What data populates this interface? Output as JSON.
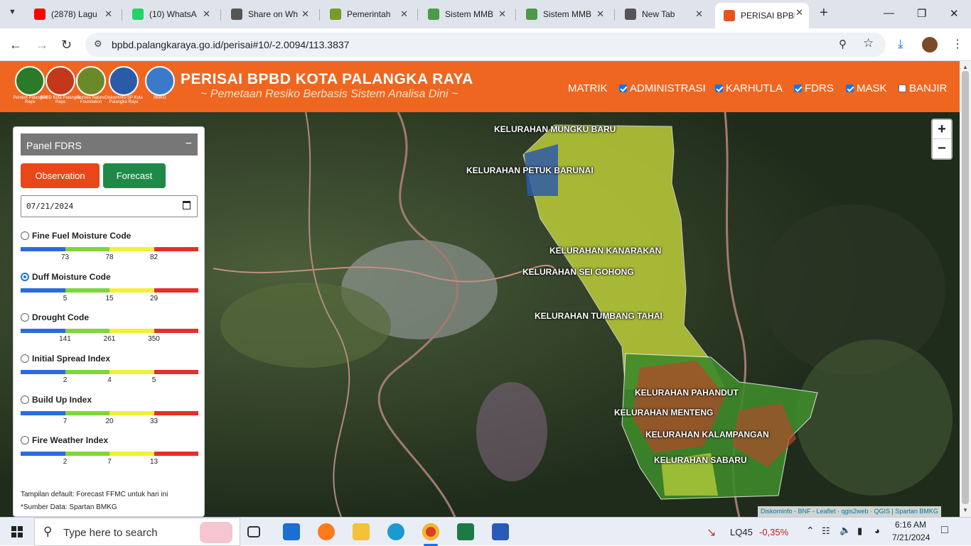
{
  "browser": {
    "tabs": [
      {
        "title": "(2878) Lagu",
        "icon": "youtube-icon",
        "color": "#ff0000"
      },
      {
        "title": "(10) WhatsA",
        "icon": "whatsapp-icon",
        "color": "#25d366"
      },
      {
        "title": "Share on Wh",
        "icon": "globe-icon",
        "color": "#555555"
      },
      {
        "title": "Pemerintah",
        "icon": "shield-icon",
        "color": "#7a9a2a"
      },
      {
        "title": "Sistem MMB",
        "icon": "map-icon",
        "color": "#4a9a4a"
      },
      {
        "title": "Sistem MMB",
        "icon": "map-icon",
        "color": "#4a9a4a"
      },
      {
        "title": "New Tab",
        "icon": "chrome-icon",
        "color": "#555555"
      },
      {
        "title": "PERISAI BPBD",
        "icon": "bpbd-icon",
        "color": "#e8521d"
      }
    ],
    "url": "bpbd.palangkaraya.go.id/perisai#10/-2.0094/113.3837"
  },
  "site": {
    "logos": [
      {
        "caption": "Pemkot Palangka Raya",
        "color": "#2a7a2a"
      },
      {
        "caption": "BPBD Kota Palangka Raya",
        "color": "#c4371b"
      },
      {
        "caption": "Borneo Nature Foundation",
        "color": "#6a8a2a"
      },
      {
        "caption": "Diskominfo-SP Kota Palangka Raya",
        "color": "#2a5aa8"
      },
      {
        "caption": "BMKG",
        "color": "#3a7ac8"
      }
    ],
    "title": "PERISAI BPBD KOTA PALANGKA RAYA",
    "subtitle": "~ Pemetaan Resiko Berbasis Sistem Analisa Dini ~",
    "menu": [
      {
        "label": "MATRIK",
        "checkbox": null
      },
      {
        "label": "ADMINISTRASI",
        "checkbox": true
      },
      {
        "label": "KARHUTLA",
        "checkbox": true
      },
      {
        "label": "FDRS",
        "checkbox": true
      },
      {
        "label": "MASK",
        "checkbox": true
      },
      {
        "label": "BANJIR",
        "checkbox": false
      }
    ]
  },
  "map": {
    "labels": [
      "KELURAHAN MUNGKU BARU",
      "KELURAHAN PETUK BARUNAI",
      "KELURAHAN KANARAKAN",
      "KELURAHAN SEI GOHONG",
      "KELURAHAN TUMBANG TAHAI",
      "KELURAHAN PAHANDUT",
      "KELURAHAN MENTENG",
      "KELURAHAN KALAMPANGAN",
      "KELURAHAN SABARU"
    ],
    "zoom_in": "+",
    "zoom_out": "−",
    "attribution": "Diskominfo - BNF - Leaflet · qgis2web · QGIS | Spartan BMKG"
  },
  "panel": {
    "title": "Panel FDRS",
    "minimize": "−",
    "observation_label": "Observation",
    "forecast_label": "Forecast",
    "date": "07/21/2024",
    "scale_colors": [
      "#2b6be0",
      "#7fd63a",
      "#f3ef3a",
      "#e3312a"
    ],
    "indices": [
      {
        "name": "Fine Fuel Moisture Code",
        "selected": false,
        "thresholds": [
          "73",
          "78",
          "82"
        ]
      },
      {
        "name": "Duff Moisture Code",
        "selected": true,
        "thresholds": [
          "5",
          "15",
          "29"
        ]
      },
      {
        "name": "Drought Code",
        "selected": false,
        "thresholds": [
          "141",
          "261",
          "350"
        ]
      },
      {
        "name": "Initial Spread Index",
        "selected": false,
        "thresholds": [
          "2",
          "4",
          "5"
        ]
      },
      {
        "name": "Build Up Index",
        "selected": false,
        "thresholds": [
          "7",
          "20",
          "33"
        ]
      },
      {
        "name": "Fire Weather Index",
        "selected": false,
        "thresholds": [
          "2",
          "7",
          "13"
        ]
      }
    ],
    "note1": "Tampilan default: Forecast FFMC untuk hari ini",
    "note2": "*Sumber Data: Spartan BMKG"
  },
  "taskbar": {
    "search_placeholder": "Type here to search",
    "stock_name": "LQ45",
    "stock_change": "-0,35%",
    "time": "6:16 AM",
    "date": "7/21/2024"
  }
}
